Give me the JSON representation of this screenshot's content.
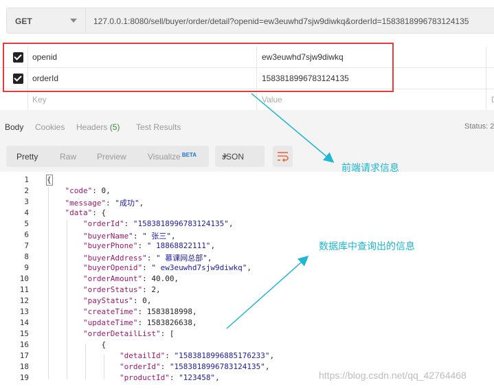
{
  "request": {
    "method": "GET",
    "url": "127.0.0.1:8080/sell/buyer/order/detail?openid=ew3euwhd7sjw9diwkq&orderId=1583818996783124135"
  },
  "params": [
    {
      "key": "openid",
      "value": "ew3euwhd7sjw9diwkq",
      "checked": true
    },
    {
      "key": "orderId",
      "value": "1583818996783124135",
      "checked": true
    }
  ],
  "params_placeholder": {
    "key": "Key",
    "value": "Value",
    "desc": "D"
  },
  "response_tabs": {
    "body": "Body",
    "cookies": "Cookies",
    "headers": "Headers",
    "headers_count": "(5)",
    "test_results": "Test Results"
  },
  "status_label": "Status: 2",
  "view_tabs": {
    "pretty": "Pretty",
    "raw": "Raw",
    "preview": "Preview",
    "visualize": "Visualize",
    "beta": "BETA"
  },
  "format_select": "JSON",
  "code_lines": [
    {
      "n": "1",
      "t": "{"
    },
    {
      "n": "2",
      "t": "    \"code\": 0,"
    },
    {
      "n": "3",
      "t": "    \"message\": \"成功\","
    },
    {
      "n": "4",
      "t": "    \"data\": {"
    },
    {
      "n": "5",
      "t": "        \"orderId\": \"1583818996783124135\","
    },
    {
      "n": "6",
      "t": "        \"buyerName\": \" 张三\","
    },
    {
      "n": "7",
      "t": "        \"buyerPhone\": \" 18868822111\","
    },
    {
      "n": "8",
      "t": "        \"buyerAddress\": \" 慕课网总部\","
    },
    {
      "n": "9",
      "t": "        \"buyerOpenid\": \" ew3euwhd7sjw9diwkq\","
    },
    {
      "n": "10",
      "t": "        \"orderAmount\": 40.00,"
    },
    {
      "n": "11",
      "t": "        \"orderStatus\": 2,"
    },
    {
      "n": "12",
      "t": "        \"payStatus\": 0,"
    },
    {
      "n": "13",
      "t": "        \"createTime\": 1583818998,"
    },
    {
      "n": "14",
      "t": "        \"updateTime\": 1583826638,"
    },
    {
      "n": "15",
      "t": "        \"orderDetailList\": ["
    },
    {
      "n": "16",
      "t": "            {"
    },
    {
      "n": "17",
      "t": "                \"detailId\": \"1583818996885176233\","
    },
    {
      "n": "18",
      "t": "                \"orderId\": \"1583818996783124135\","
    },
    {
      "n": "19",
      "t": "                \"productId\": \"123458\","
    }
  ],
  "annotations": {
    "front_request": "前端请求信息",
    "db_result": "数据库中查询出的信息"
  },
  "watermark": "https://blog.csdn.net/qq_42764468",
  "colors": {
    "annotation": "#1fb7d4",
    "highlight_box": "#e8393c",
    "arrow": "#1fb7d4"
  }
}
